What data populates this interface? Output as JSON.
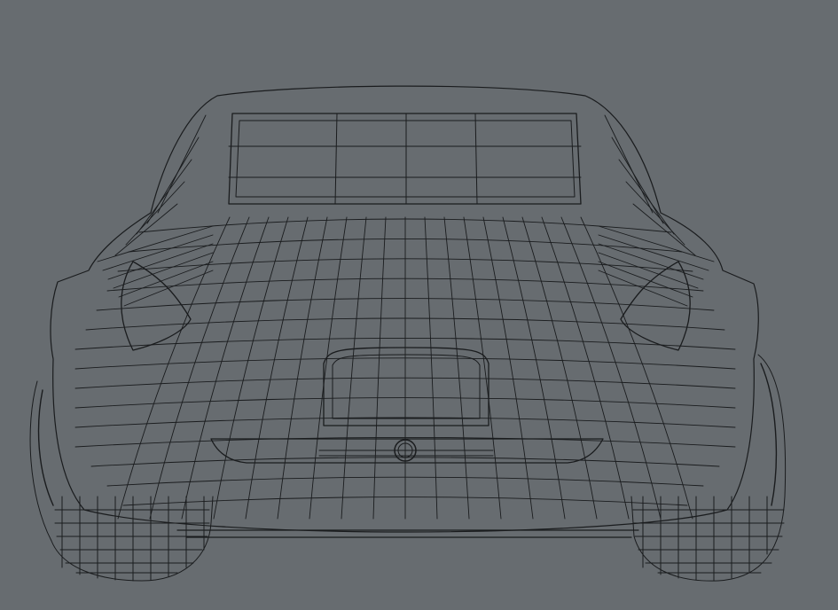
{
  "viewport": {
    "background_color": "#676c70",
    "wire_color": "#1a1c1e",
    "subject": "wireframe-car-mesh-rear-view"
  }
}
